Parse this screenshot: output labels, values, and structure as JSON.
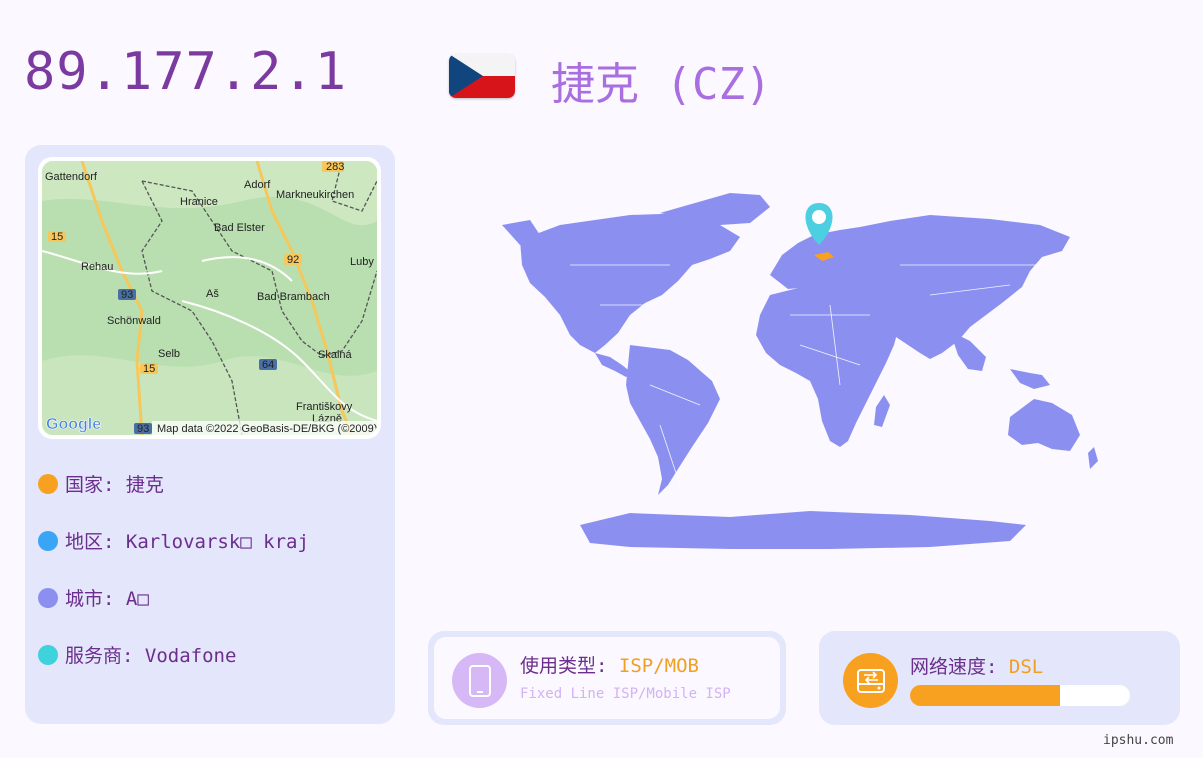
{
  "ip": "89.177.2.1",
  "country_title": "捷克 (CZ)",
  "map": {
    "places": [
      "Gattendorf",
      "Adorf",
      "Markneukirchen",
      "Hranice",
      "Bad Elster",
      "Rehau",
      "Luby",
      "Aš",
      "Bad Brambach",
      "Schönwald",
      "Selb",
      "Skalná",
      "Františkovy",
      "Lázně"
    ],
    "roads": [
      "283",
      "15",
      "92",
      "93",
      "15",
      "64",
      "93"
    ],
    "logo": "Google",
    "attribution": "Map data ©2022 GeoBasis-DE/BKG (©2009)"
  },
  "info": [
    {
      "label": "国家: 捷克",
      "color": "#f8a020"
    },
    {
      "label": "地区: Karlovarsk□ kraj",
      "color": "#3aa4f6"
    },
    {
      "label": "城市: A□",
      "color": "#8b90f0"
    },
    {
      "label": "服务商: Vodafone",
      "color": "#3ed2dc"
    }
  ],
  "usage": {
    "label": "使用类型: ",
    "value": "ISP/MOB",
    "detail": "Fixed Line ISP/Mobile ISP",
    "icon": "phone-icon"
  },
  "speed": {
    "label": "网络速度: ",
    "value": "DSL",
    "progress": 0.68,
    "icon": "network-drive-icon"
  },
  "footer": "ipshu.com",
  "colors": {
    "accent": "#7b3aa0",
    "land": "#8b90f0",
    "highlight": "#f8a020",
    "marker": "#4ccfe0"
  }
}
